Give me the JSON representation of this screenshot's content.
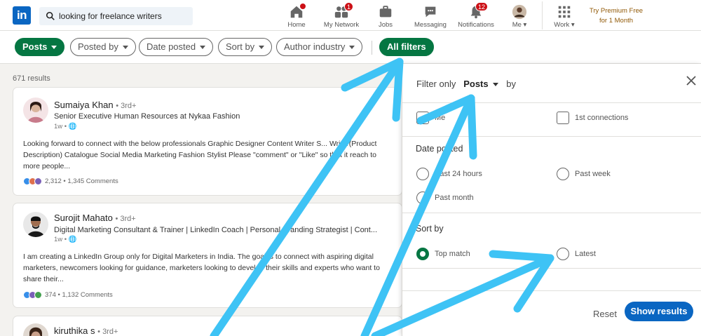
{
  "nav": {
    "search_value": "looking for freelance writers",
    "items": [
      {
        "label": "Home",
        "badge": ""
      },
      {
        "label": "My Network",
        "badge": "1"
      },
      {
        "label": "Jobs",
        "badge": ""
      },
      {
        "label": "Messaging",
        "badge": ""
      },
      {
        "label": "Notifications",
        "badge": "12"
      },
      {
        "label": "Me ▾",
        "badge": ""
      },
      {
        "label": "Work ▾",
        "badge": ""
      }
    ],
    "premium_line1": "Try Premium Free",
    "premium_line2": "for 1 Month"
  },
  "filters": {
    "posts": "Posts",
    "posted_by": "Posted by",
    "date_posted": "Date posted",
    "sort_by": "Sort by",
    "author_industry": "Author industry",
    "all_filters": "All filters"
  },
  "results": {
    "count": "671 results",
    "posts": [
      {
        "name": "Sumaiya Khan",
        "degree": "• 3rd+",
        "headline": "Senior Executive Human Resources at Nykaa Fashion",
        "time": "1w •",
        "text": "Looking forward to connect with the below professionals Graphic Designer Content Writer S... Writer(Product Description) Catalogue Social Media Marketing Fashion Stylist Please \"comment\" or \"Like\" so that it reach to more people...",
        "reactions": "2,312 • 1,345 Comments"
      },
      {
        "name": "Surojit Mahato",
        "degree": "• 3rd+",
        "headline": "Digital Marketing Consultant & Trainer | LinkedIn Coach | Personal Branding Strategist | Cont...",
        "time": "1w •",
        "text": "I am creating a LinkedIn Group only for Digital Marketers in India. The goal is to connect with aspiring digital marketers, newcomers looking for guidance, marketers looking to develop their skills and experts who want to share their...",
        "reactions": "374 • 1,132 Comments"
      },
      {
        "name": "kiruthika s",
        "degree": "• 3rd+"
      }
    ]
  },
  "panel": {
    "filter_only": "Filter only",
    "posts": "Posts",
    "by": "by",
    "opt_me": "Me",
    "opt_1st": "1st connections",
    "date_posted": "Date posted",
    "past_24": "Past 24 hours",
    "past_week": "Past week",
    "past_month": "Past month",
    "sort_by": "Sort by",
    "top_match": "Top match",
    "latest": "Latest",
    "reset": "Reset",
    "show_results": "Show results"
  },
  "colors": {
    "brand": "#0a66c2",
    "active_green": "#057642",
    "arrow": "#3ec3f5"
  }
}
